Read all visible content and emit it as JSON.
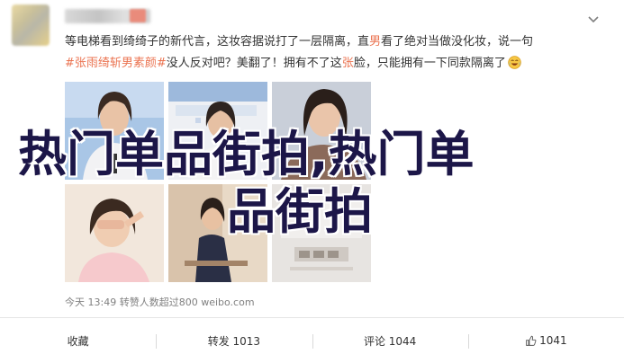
{
  "post": {
    "line1_a": "等电梯看到绮绮子的新代言，这妆容据说打了一层隔离，直",
    "line1_hl": "男",
    "line1_b": "看了绝对当做没化妆，说一句",
    "line2_link": "#张雨绮斩男素颜#",
    "line2_a": "没人反对吧？美翻了！拥有不了这",
    "line2_hl": "张",
    "line2_b": "脸，只能拥有一下同款隔离了",
    "emoji": "laughing-tears-emoji"
  },
  "overlay": {
    "line1": "热门单品街拍,热门单",
    "line2": "品街拍"
  },
  "meta": {
    "time": "今天 13:49",
    "likes": "转赞人数超过800",
    "source": "weibo.com"
  },
  "actions": {
    "favorite": "收藏",
    "repost": "转发 1013",
    "comment": "评论 1044",
    "like": "1041"
  },
  "colors": {
    "highlight": "#eb7350",
    "overlay_text": "#1c1648"
  }
}
